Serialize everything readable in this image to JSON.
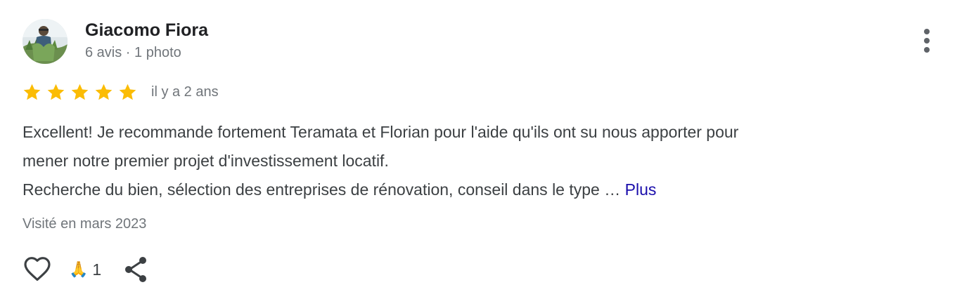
{
  "review": {
    "reviewer": {
      "name": "Giacomo Fiora",
      "meta": "6 avis · 1 photo",
      "avatar_icon": "person-photo-avatar"
    },
    "rating": {
      "stars": 5,
      "max": 5,
      "star_color": "#fbbc04",
      "date": "il y a 2 ans"
    },
    "text": {
      "line1": "Excellent! Je recommande fortement Teramata et Florian pour l'aide qu'ils ont su nous apporter pour",
      "line2": "mener notre premier projet d'investissement locatif.",
      "line3": "Recherche du bien, sélection des entreprises de rénovation, conseil dans le type …",
      "more_label": "Plus"
    },
    "visit": "Visité en mars 2023",
    "actions": {
      "like_icon": "heart-outline-icon",
      "reaction_emoji": "🙏",
      "reaction_count": "1",
      "share_icon": "share-icon",
      "more_icon": "more-vert-icon"
    }
  },
  "colors": {
    "link": "#1a0dab",
    "secondary_text": "#70757a",
    "primary_text": "#3c4043",
    "name_text": "#202124"
  }
}
